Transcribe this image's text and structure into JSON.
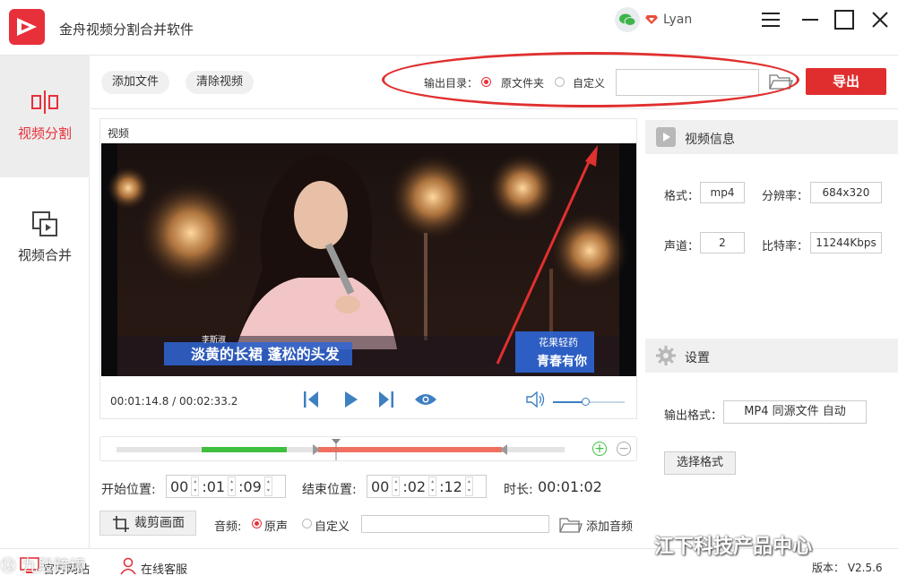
{
  "app": {
    "title": "金舟视频分割合并软件"
  },
  "user": {
    "name": "Lyan"
  },
  "sidebar": {
    "items": [
      {
        "label": "视频分割",
        "active": true,
        "icon": "split-icon"
      },
      {
        "label": "视频合并",
        "active": false,
        "icon": "merge-icon"
      }
    ]
  },
  "toolbar": {
    "add_file": "添加文件",
    "clear_video": "清除视频",
    "output_dir_label": "输出目录：",
    "option_original": "原文件夹",
    "option_custom": "自定义",
    "output_path": "",
    "export": "导出"
  },
  "video": {
    "panel_label": "视频",
    "current_time": "00:01:14.8",
    "total_time": "00:02:33.2",
    "time_separator": "/",
    "subtitle_line": "淡黄的长裙 蓬松的头发",
    "caption_name": "李斯淑",
    "badge_top": "花果轻药",
    "badge_bottom": "青春有你",
    "volume_level": 0.45
  },
  "timeline": {
    "green_start": 0.19,
    "green_end": 0.38,
    "red_start": 0.45,
    "red_end": 0.86,
    "playhead": 0.49
  },
  "range": {
    "start_label": "开始位置:",
    "start_h": "00",
    "start_m": "01",
    "start_s": "09",
    "end_label": "结束位置:",
    "end_h": "00",
    "end_m": "02",
    "end_s": "12",
    "duration_label": "时长:",
    "duration_value": "00:01:02"
  },
  "bottom": {
    "crop_button": "裁剪画面",
    "audio_label": "音频:",
    "audio_original": "原声",
    "audio_custom": "自定义",
    "audio_path": "",
    "add_audio": "添加音频"
  },
  "info": {
    "title": "视频信息",
    "format_label": "格式：",
    "format_value": "mp4",
    "resolution_label": "分辨率：",
    "resolution_value": "684x320",
    "channels_label": "声道：",
    "channels_value": "2",
    "bitrate_label": "比特率：",
    "bitrate_value": "11244Kbps"
  },
  "settings": {
    "title": "设置",
    "output_format_label": "输出格式：",
    "output_format_value": "MP4 同源文件 自动",
    "select_format": "选择格式"
  },
  "footer": {
    "website": "官方网站",
    "support": "在线客服",
    "version": "版本： V2.5.6"
  },
  "watermark": {
    "text": "江下科技产品中心",
    "corner": "⑫ 九段跨境"
  },
  "colors": {
    "accent": "#e8303a",
    "export": "#e02e2e",
    "green": "#3fbf3f",
    "red_segment": "#f07060",
    "blue": "#3d7fc1"
  }
}
